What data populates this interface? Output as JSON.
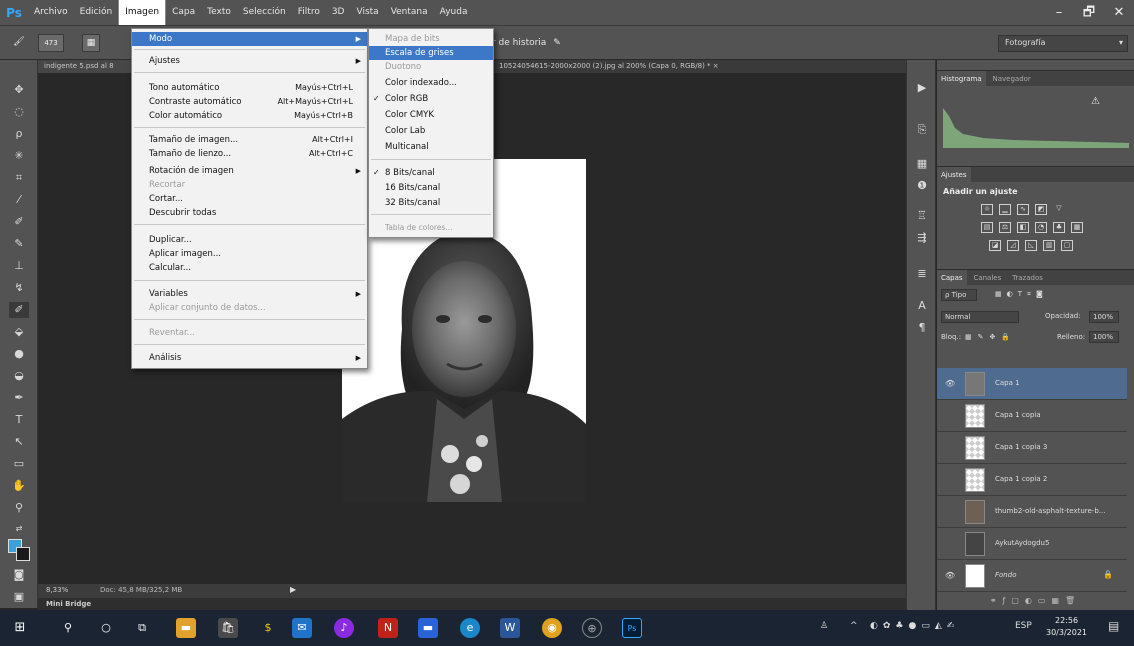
{
  "menubar": {
    "logo": "Ps",
    "items": [
      "Archivo",
      "Edición",
      "Imagen",
      "Capa",
      "Texto",
      "Selección",
      "Filtro",
      "3D",
      "Vista",
      "Ventana",
      "Ayuda"
    ],
    "window_controls": [
      "–",
      "🗗",
      "✕"
    ]
  },
  "options": {
    "brush_size": "473",
    "history_label": "r de historia",
    "workspace": "Fotografía"
  },
  "tabs": {
    "left": "indigente 5.psd al 8",
    "active": "10524054615-2000x2000 (2).jpg al 200% (Capa 0, RGB/8) * ×"
  },
  "imagen_menu": {
    "modo": "Modo",
    "ajustes": "Ajustes",
    "tono_auto": "Tono automático",
    "tono_auto_sc": "Mayús+Ctrl+L",
    "contraste_auto": "Contraste automático",
    "contraste_auto_sc": "Alt+Mayús+Ctrl+L",
    "color_auto": "Color automático",
    "color_auto_sc": "Mayús+Ctrl+B",
    "tam_imagen": "Tamaño de imagen...",
    "tam_imagen_sc": "Alt+Ctrl+I",
    "tam_lienzo": "Tamaño de lienzo...",
    "tam_lienzo_sc": "Alt+Ctrl+C",
    "rotacion": "Rotación de imagen",
    "recortar": "Recortar",
    "cortar": "Cortar...",
    "descubrir": "Descubrir todas",
    "duplicar": "Duplicar...",
    "aplicar_imagen": "Aplicar imagen...",
    "calcular": "Calcular...",
    "variables": "Variables",
    "aplicar_conjunto": "Aplicar conjunto de datos...",
    "reventar": "Reventar...",
    "analisis": "Análisis"
  },
  "modo_menu": {
    "mapa_bits": "Mapa de bits",
    "escala_grises": "Escala de grises",
    "duotono": "Duotono",
    "color_indexado": "Color indexado...",
    "color_rgb": "Color RGB",
    "color_cmyk": "Color CMYK",
    "color_lab": "Color Lab",
    "multicanal": "Multicanal",
    "bits8": "8 Bits/canal",
    "bits16": "16 Bits/canal",
    "bits32": "32 Bits/canal",
    "tabla_colores": "Tabla de colores...",
    "checkmark": "✓"
  },
  "status": {
    "zoom": "8,33%",
    "doc": "Doc: 45,8 MB/325,2 MB",
    "minibridge": "Mini Bridge"
  },
  "panels": {
    "histograma": "Histograma",
    "navegador": "Navegador",
    "ajustes_tab": "Ajustes",
    "anadir_ajuste": "Añadir un ajuste",
    "capas": "Capas",
    "canales": "Canales",
    "trazados": "Trazados",
    "tipo": "ρ Tipo",
    "blend_mode": "Normal",
    "opacidad_label": "Opacidad:",
    "opacidad": "100%",
    "bloq": "Bloq.:",
    "relleno_label": "Relleno:",
    "relleno": "100%"
  },
  "layers": [
    {
      "name": "Capa 1"
    },
    {
      "name": "Capa 1 copia"
    },
    {
      "name": "Capa 1 copia 3"
    },
    {
      "name": "Capa 1 copia 2"
    },
    {
      "name": "thumb2-old-asphalt-texture-b..."
    },
    {
      "name": "AykutAydogdu5"
    },
    {
      "name": "Fondo"
    }
  ],
  "taskbar": {
    "lang": "ESP",
    "time": "22:56",
    "date": "30/3/2021"
  },
  "colors": {
    "accent": "#3c78c7",
    "foreground": "#3da0d8",
    "taskbar": "#1b2433"
  }
}
